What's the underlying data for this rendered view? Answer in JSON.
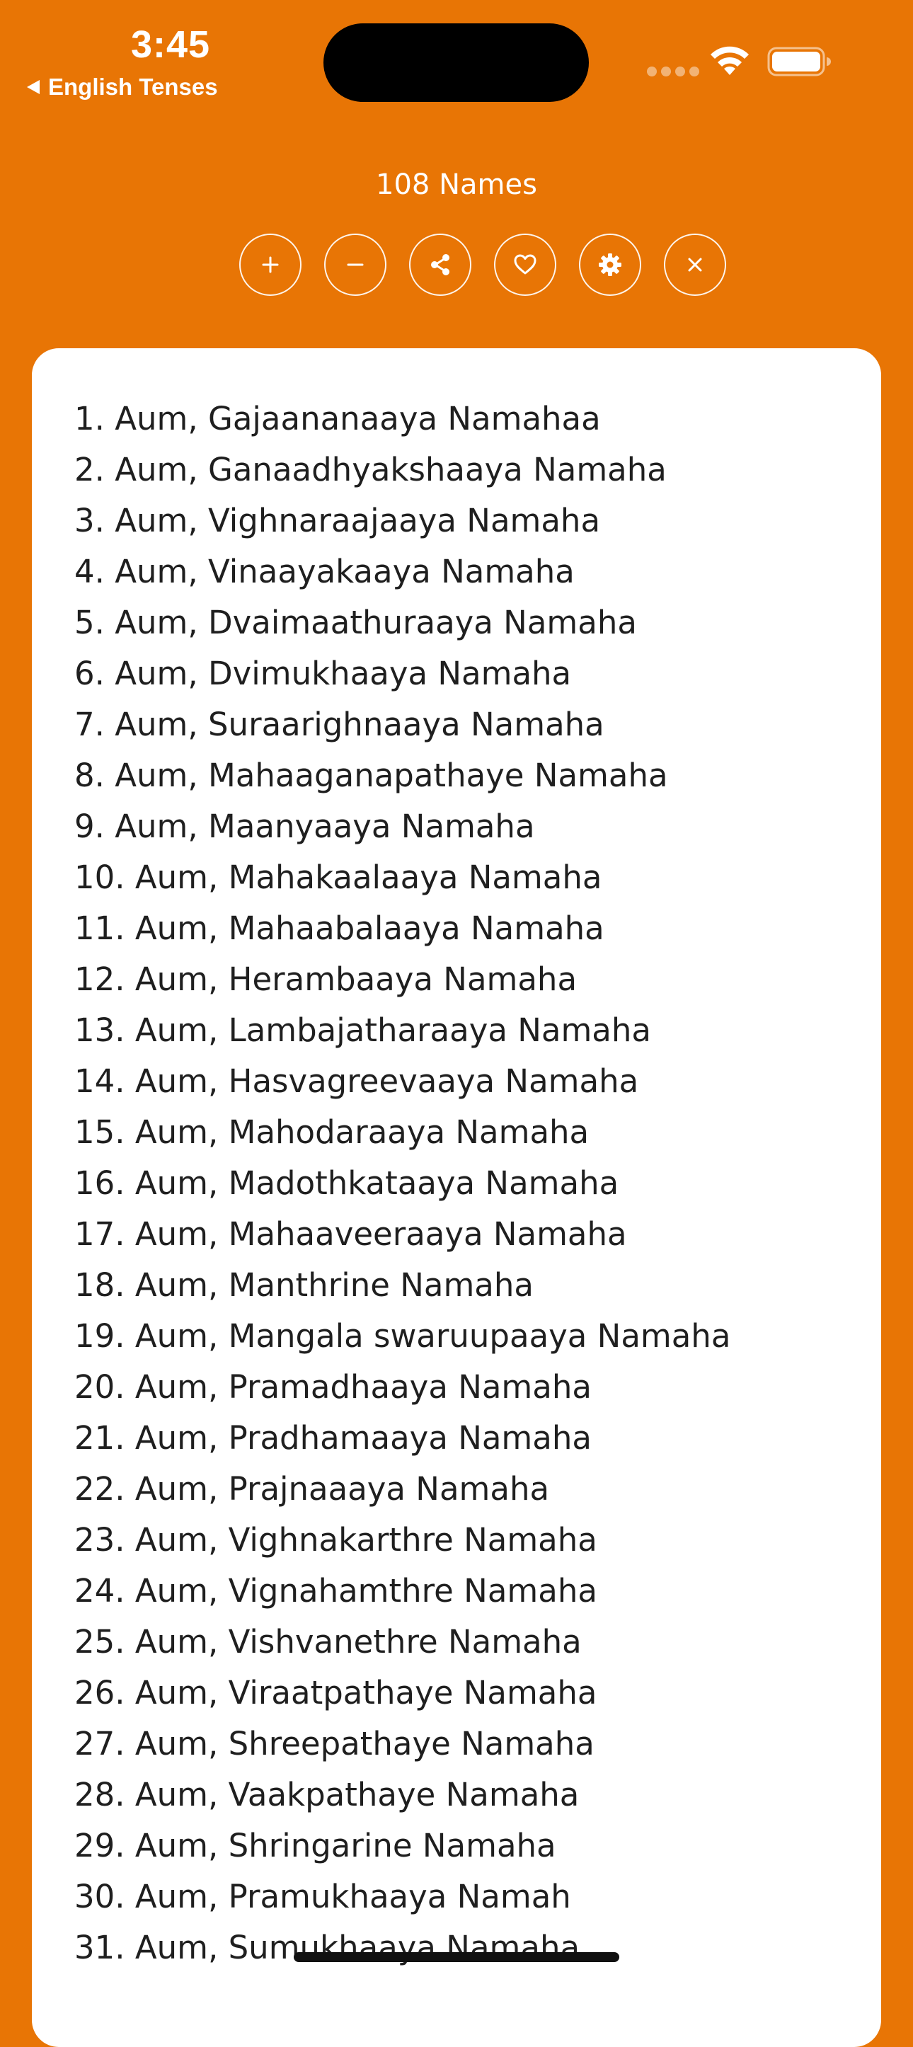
{
  "status_bar": {
    "time": "3:45",
    "back_label": "English Tenses"
  },
  "header": {
    "title": "108 Names"
  },
  "toolbar": {
    "buttons": [
      {
        "name": "zoom-in-button",
        "icon": "plus-icon"
      },
      {
        "name": "zoom-out-button",
        "icon": "minus-icon"
      },
      {
        "name": "share-button",
        "icon": "share-icon"
      },
      {
        "name": "favorite-button",
        "icon": "heart-icon"
      },
      {
        "name": "settings-button",
        "icon": "gear-icon"
      },
      {
        "name": "close-button",
        "icon": "close-icon"
      }
    ]
  },
  "colors": {
    "background": "#E87505",
    "card": "#FFFFFF",
    "text": "#1F1F1F"
  },
  "names": [
    "1. Aum, Gajaananaaya Namahaa",
    "2. Aum, Ganaadhyakshaaya Namaha",
    "3. Aum, Vighnaraajaaya Namaha",
    "4. Aum, Vinaayakaaya Namaha",
    "5. Aum, Dvaimaathuraaya Namaha",
    "6. Aum, Dvimukhaaya Namaha",
    "7. Aum, Suraarighnaaya Namaha",
    "8. Aum, Mahaaganapathaye Namaha",
    "9. Aum, Maanyaaya Namaha",
    "10. Aum, Mahakaalaaya Namaha",
    "11. Aum, Mahaabalaaya Namaha",
    "12. Aum, Herambaaya Namaha",
    "13. Aum, Lambajatharaaya Namaha",
    "14. Aum, Hasvagreevaaya Namaha",
    "15. Aum, Mahodaraaya Namaha",
    "16. Aum, Madothkataaya Namaha",
    "17. Aum, Mahaaveeraaya Namaha",
    "18. Aum, Manthrine Namaha",
    "19. Aum, Mangala swaruupaaya Namaha",
    "20. Aum, Pramadhaaya Namaha",
    "21. Aum, Pradhamaaya Namaha",
    "22. Aum, Prajnaaaya Namaha",
    "23. Aum, Vighnakarthre Namaha",
    "24. Aum, Vignahamthre Namaha",
    "25. Aum, Vishvanethre Namaha",
    "26. Aum, Viraatpathaye Namaha",
    "27. Aum, Shreepathaye Namaha",
    "28. Aum, Vaakpathaye Namaha",
    "29. Aum, Shringarine Namaha",
    "30. Aum, Pramukhaaya Namah",
    "31. Aum, Sumukhaaya Namaha"
  ]
}
